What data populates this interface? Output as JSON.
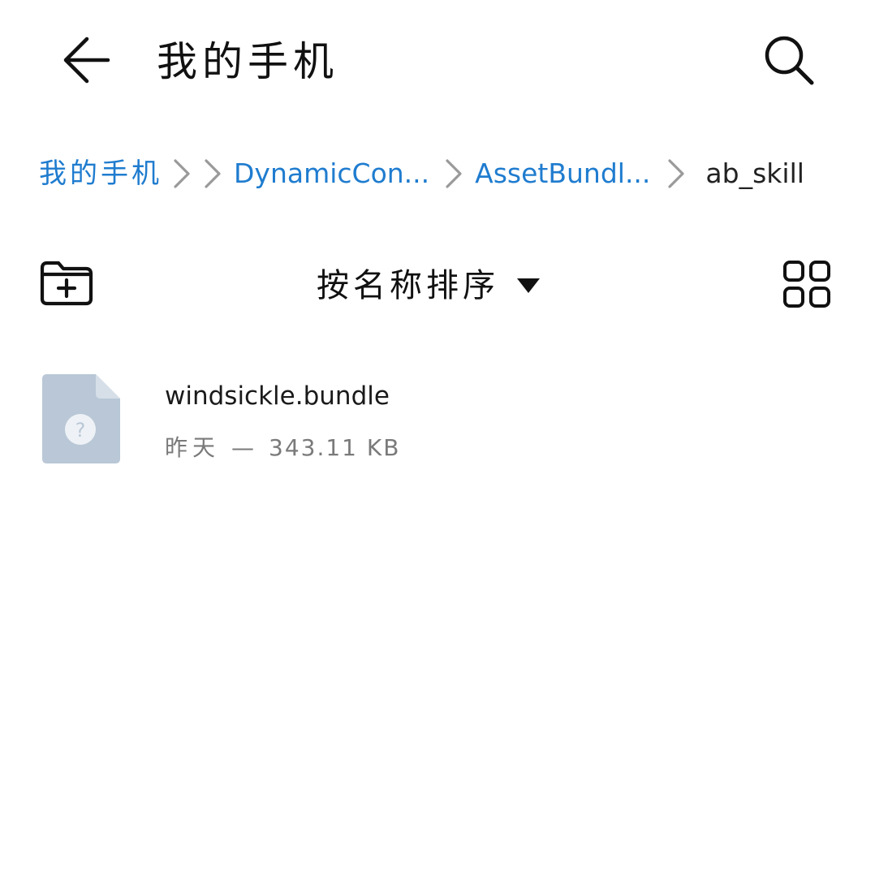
{
  "header": {
    "title": "我的手机",
    "back_icon": "arrow-left-icon",
    "search_icon": "search-icon"
  },
  "breadcrumb": {
    "items": [
      {
        "label": "我的手机"
      },
      {
        "label": "DynamicCon..."
      },
      {
        "label": "AssetBundl..."
      },
      {
        "label": "ab_skill"
      }
    ],
    "separator_icon": "chevron-right-icon"
  },
  "toolbar": {
    "new_folder_icon": "new-folder-icon",
    "sort_label": "按名称排序",
    "sort_arrow_icon": "triangle-down-icon",
    "view_toggle_icon": "grid-view-icon"
  },
  "files": [
    {
      "name": "windsickle.bundle",
      "date": "昨天",
      "separator": "—",
      "size": "343.11 KB",
      "icon": "unknown-file-icon"
    }
  ],
  "colors": {
    "accent": "#1f7ccf",
    "text": "#1a1a1a",
    "secondary_text": "#7a7a7a",
    "file_icon": "#b9c7d6"
  }
}
